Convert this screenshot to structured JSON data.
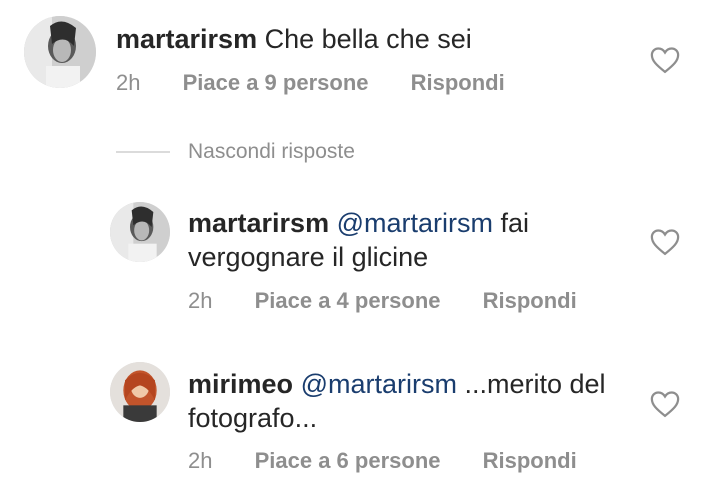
{
  "comments": [
    {
      "username": "martarirsm",
      "mention": "",
      "text": "Che bella che sei",
      "time": "2h",
      "likes": "Piace a 9 persone",
      "reply": "Rispondi"
    },
    {
      "username": "martarirsm",
      "mention": "@martarirsm",
      "text_line1": "fai",
      "text_line2": "vergognare il glicine",
      "time": "2h",
      "likes": "Piace a 4 persone",
      "reply": "Rispondi"
    },
    {
      "username": "mirimeo",
      "mention": "@martarirsm",
      "text_line1": "...merito del",
      "text_line2": "fotografo...",
      "time": "2h",
      "likes": "Piace a 6 persone",
      "reply": "Rispondi"
    }
  ],
  "hide_replies": "Nascondi risposte",
  "icons": {
    "like": "heart-icon"
  },
  "colors": {
    "mention": "#1a3d6e",
    "meta": "#8e8e8e",
    "text": "#262626"
  }
}
